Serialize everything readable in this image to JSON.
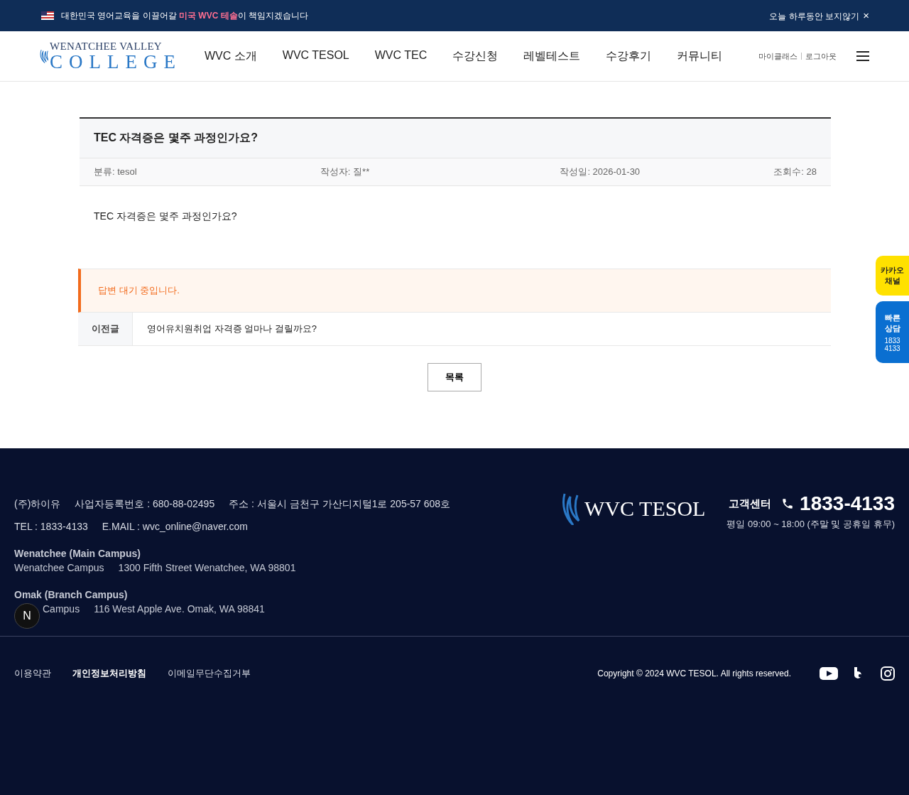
{
  "top_banner": {
    "text": "대한민국 영어교육을 이끌어갈 **미국 WVC 테솔**이 책임지겠습니다",
    "dismiss": "오늘 하루동안 보지않기",
    "close": "×"
  },
  "header": {
    "logo": {
      "line1": "WENATCHEE VALLEY",
      "line2": "COLLEGE"
    },
    "nav": [
      {
        "label": "WVC 소개",
        "selected": false
      },
      {
        "label": "WVC TESOL",
        "selected": false
      },
      {
        "label": "WVC TEC",
        "selected": false
      },
      {
        "label": "수강신청",
        "selected": false
      },
      {
        "label": "레벨테스트",
        "selected": false
      },
      {
        "label": "수강후기",
        "selected": false
      },
      {
        "label": "커뮤니티",
        "selected": false
      }
    ],
    "user_links": [
      "마이클래스",
      "로그아웃"
    ]
  },
  "post": {
    "title": "TEC 자격증은 몇주 과정인가요?",
    "meta": [
      "분류: tesol",
      "작성자: 질**",
      "작성일: 2026-01-30",
      "조회수: 28"
    ],
    "body": "TEC 자격증은 몇주 과정인가요?",
    "answer_status": "답변 대기 중입니다.",
    "prev": {
      "label": "이전글",
      "title": "영어유치원취업 자격증 얼마나 걸릴까요?"
    },
    "list_button": "목록"
  },
  "side_buttons": [
    {
      "kind": "kakao",
      "lines": [
        "카카오",
        "채널"
      ]
    },
    {
      "kind": "consult",
      "lines": [
        "빠른",
        "상담"
      ],
      "sub": [
        "1833",
        "4133"
      ]
    }
  ],
  "footer": {
    "company_lines": [
      [
        "(주)하이유",
        "사업자등록번호 : 680-88-02495",
        "주소 : 서울시 금천구 가산디지털1로 205-57 608호"
      ],
      [
        "TEL : 1833-4133",
        "E.MAIL : wvc_online@naver.com"
      ]
    ],
    "campuses": [
      {
        "heading": "Wenatchee (Main Campus)",
        "name": "Wenatchee Campus",
        "address": "1300 Fifth Street Wenatchee, WA 98801"
      },
      {
        "heading": "Omak (Branch Campus)",
        "name": "Campus",
        "address": "116 West Apple Ave. Omak, WA 98841"
      }
    ],
    "logo": "WVC TESOL",
    "cs_label": "고객센터",
    "phone": "1833-4133",
    "hours": "평일 09:00 ~ 18:00 (주말 및 공휴일 휴무)",
    "links": [
      {
        "label": "이용약관",
        "bold": false
      },
      {
        "label": "개인정보처리방침",
        "bold": true
      },
      {
        "label": "이메일무단수집거부",
        "bold": false
      }
    ],
    "copyright": "Copyright © 2024 WVC TESOL. All rights reserved.",
    "badge": "N"
  }
}
